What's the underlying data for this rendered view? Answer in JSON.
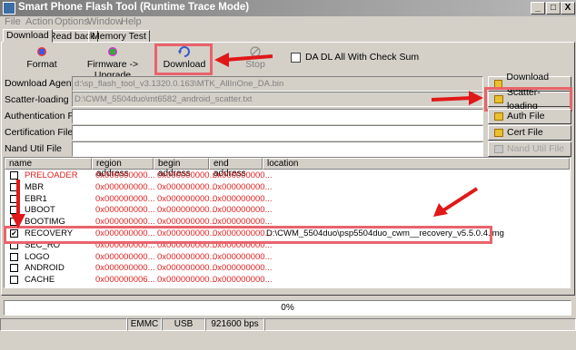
{
  "window": {
    "title": "Smart Phone Flash Tool (Runtime Trace Mode)",
    "controls": [
      "_",
      "□",
      "X"
    ]
  },
  "menu": [
    "File",
    "Action",
    "Options",
    "Window",
    "Help"
  ],
  "tabs": [
    "Download",
    "Read back",
    "Memory Test"
  ],
  "toolbar": {
    "format": "Format",
    "firmware": "Firmware -> Upgrade",
    "download": "Download",
    "stop": "Stop"
  },
  "da_checksum_label": "DA DL All With Check Sum",
  "fields": [
    {
      "label": "Download Agent",
      "value": "d:\\sp_flash_tool_v3.1320.0.163\\MTK_AllInOne_DA.bin",
      "button": "Download Agent",
      "enabled": true
    },
    {
      "label": "Scatter-loading File",
      "value": "D:\\CWM_5504duo\\mt6582_android_scatter.txt",
      "button": "Scatter-loading",
      "enabled": true
    },
    {
      "label": "Authentication File",
      "value": "",
      "button": "Auth File",
      "enabled": true
    },
    {
      "label": "Certification File",
      "value": "",
      "button": "Cert File",
      "enabled": true
    },
    {
      "label": "Nand Util File",
      "value": "",
      "button": "Nand Util File",
      "enabled": false
    }
  ],
  "table": {
    "columns": [
      "name",
      "region address",
      "begin address",
      "end address",
      "location"
    ],
    "rows": [
      {
        "name": "PRELOADER",
        "region": "0x000000000...",
        "begin": "0x000000000...",
        "end": "0x000000000...",
        "location": "",
        "checked": false,
        "red": true
      },
      {
        "name": "MBR",
        "region": "0x000000000...",
        "begin": "0x000000000...",
        "end": "0x000000000...",
        "location": "",
        "checked": false,
        "red": false
      },
      {
        "name": "EBR1",
        "region": "0x000000000...",
        "begin": "0x000000000...",
        "end": "0x000000000...",
        "location": "",
        "checked": false,
        "red": false
      },
      {
        "name": "UBOOT",
        "region": "0x000000000...",
        "begin": "0x000000000...",
        "end": "0x000000000...",
        "location": "",
        "checked": false,
        "red": false
      },
      {
        "name": "BOOTIMG",
        "region": "0x000000000...",
        "begin": "0x000000000...",
        "end": "0x000000000...",
        "location": "",
        "checked": false,
        "red": false
      },
      {
        "name": "RECOVERY",
        "region": "0x000000000...",
        "begin": "0x000000000...",
        "end": "0x000000000...",
        "location": "D:\\CWM_5504duo\\psp5504duo_cwm__recovery_v5.5.0.4.img",
        "checked": true,
        "red": false
      },
      {
        "name": "SEC_RO",
        "region": "0x000000000...",
        "begin": "0x000000000...",
        "end": "0x000000000...",
        "location": "",
        "checked": false,
        "red": false
      },
      {
        "name": "LOGO",
        "region": "0x000000000...",
        "begin": "0x000000000...",
        "end": "0x000000000...",
        "location": "",
        "checked": false,
        "red": false
      },
      {
        "name": "ANDROID",
        "region": "0x000000000...",
        "begin": "0x000000000...",
        "end": "0x000000000...",
        "location": "",
        "checked": false,
        "red": false
      },
      {
        "name": "CACHE",
        "region": "0x000000006...",
        "begin": "0x000000000...",
        "end": "0x000000000...",
        "location": "",
        "checked": false,
        "red": false
      }
    ]
  },
  "progress": {
    "text": "0%",
    "value": 0
  },
  "status": {
    "storage": "EMMC",
    "port": "USB",
    "baud": "921600 bps"
  },
  "colors": {
    "highlight": "#e8636b",
    "arrow": "#e01818",
    "red_text": "#e02020"
  }
}
